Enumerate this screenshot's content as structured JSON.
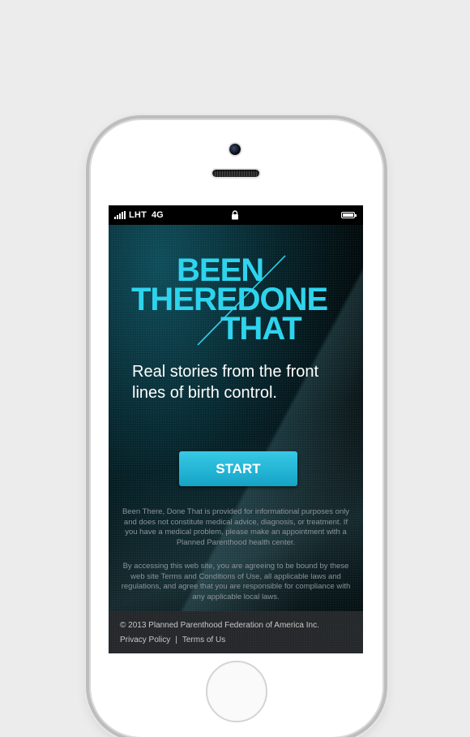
{
  "status_bar": {
    "carrier": "LHT",
    "network": "4G",
    "icons": [
      "signal-bars-icon",
      "lock-icon",
      "battery-icon"
    ]
  },
  "hero": {
    "logo_lines": [
      "BEEN",
      "THEREDONE",
      "THAT"
    ],
    "tagline": "Real stories from the front lines of birth control."
  },
  "start_button": {
    "label": "START"
  },
  "disclaimers": [
    "Been There, Done That is provided for informational purposes only and does not constitute medical advice, diagnosis, or treatment. If you have a medical problem, please make an appointment with a Planned Parenthood health center.",
    "By accessing this web site, you are agreeing to be bound by these web site Terms and Conditions of Use, all applicable laws and regulations, and agree that you are responsible for compliance with any applicable local laws."
  ],
  "footer": {
    "copyright": "© 2013 Planned Parenthood Federation of America Inc.",
    "privacy_link": "Privacy Policy",
    "separator": "|",
    "terms_link": "Terms of Us"
  },
  "colors": {
    "accent": "#2ed4ee",
    "button": "#1fb3d5",
    "footer_bg": "#26292b"
  }
}
